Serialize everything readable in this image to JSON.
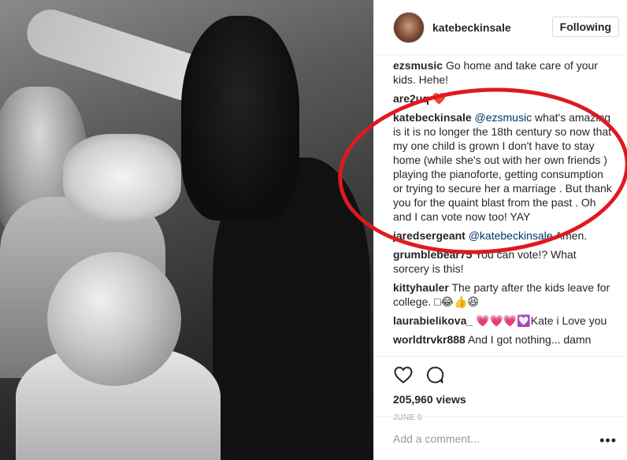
{
  "post": {
    "username": "katebeckinsale",
    "follow_label": "Following"
  },
  "comments": [
    {
      "author": "ezsmusic",
      "mention": "",
      "text": "Go home and take care of your kids. Hehe!"
    },
    {
      "author": "are2uq",
      "mention": "",
      "text": "❤️"
    },
    {
      "author": "katebeckinsale",
      "mention": "@ezsmusic",
      "text": "what's amazing is it is no longer the 18th century so now that my one child is grown I don't have to stay home (while she's out with her own friends ) playing the pianoforte, getting consumption or trying to secure her a marriage . But thank you for the quaint blast from the past . Oh and I can vote now too! YAY"
    },
    {
      "author": "jaredsergeant",
      "mention": "@katebeckinsale",
      "text": "Amen."
    },
    {
      "author": "grumblebear75",
      "mention": "",
      "text": "You can vote!? What sorcery is this!"
    },
    {
      "author": "kittyhauler",
      "mention": "",
      "text": "The party after the kids leave for college. □😂👍😆"
    },
    {
      "author": "laurabielikova_",
      "mention": "",
      "text": "💗💗💗💟Kate i Love you"
    },
    {
      "author": "worldtrvkr888",
      "mention": "",
      "text": "And I got nothing... damn"
    }
  ],
  "actions": {
    "views": "205,960 views",
    "date": "JUNE 6",
    "add_comment_placeholder": "Add a comment...",
    "more_label": "•••"
  },
  "colors": {
    "annotation_ring": "#e0191f",
    "mention": "#003569"
  }
}
